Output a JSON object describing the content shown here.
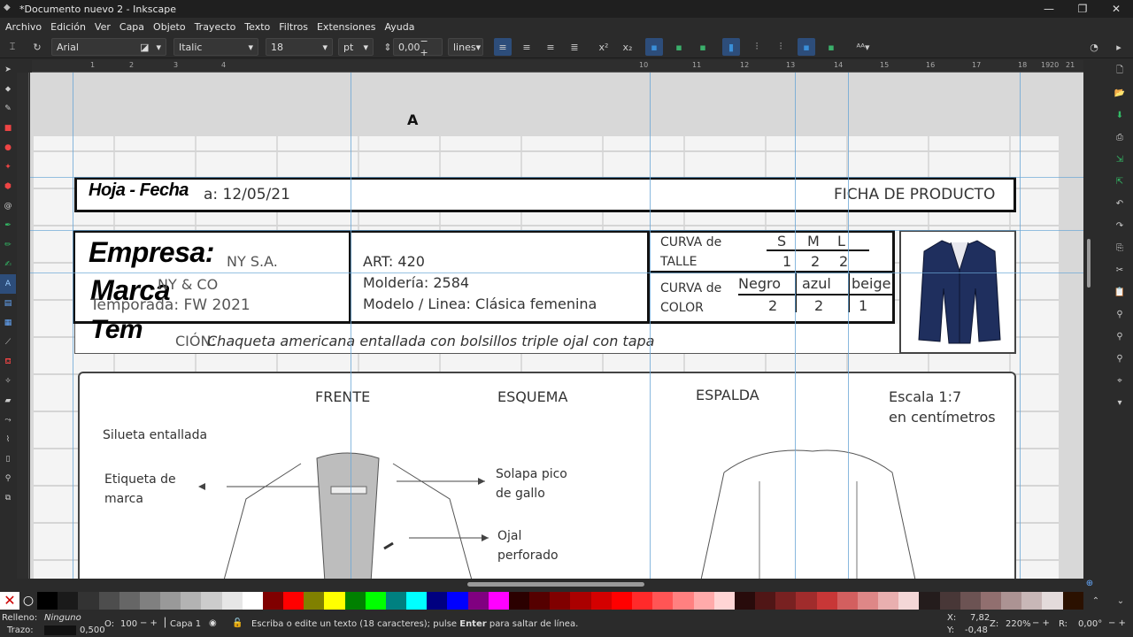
{
  "window": {
    "title": "*Documento nuevo 2 - Inkscape",
    "minimize": "—",
    "maximize": "❐",
    "close": "✕"
  },
  "menu": [
    "Archivo",
    "Edición",
    "Ver",
    "Capa",
    "Objeto",
    "Trayecto",
    "Texto",
    "Filtros",
    "Extensiones",
    "Ayuda"
  ],
  "textbar": {
    "font_family": "Arial",
    "font_style": "Italic",
    "font_size": "18",
    "unit": "pt",
    "spacing": "0,00",
    "line_mode": "lines"
  },
  "document": {
    "hoja_fecha": "Hoja - Fecha",
    "fecha_value": "a: 12/05/21",
    "ficha": "FICHA DE PRODUCTO",
    "empresa": "Empresa:",
    "marca": "Marca",
    "temporada": "Tem",
    "empresa_value": "NY S.A.",
    "marca_value": "NY & CO",
    "temporada_value": "Temporada: FW 2021",
    "art": "ART: 420",
    "molderia": "Moldería: 2584",
    "modelo": "Modelo / Linea: Clásica femenina",
    "curva_talle_1": "CURVA de",
    "curva_talle_2": "TALLE",
    "sizes": [
      "S",
      "M",
      "L"
    ],
    "size_qty": [
      "1",
      "2",
      "2"
    ],
    "curva_color_1": "CURVA de",
    "curva_color_2": "COLOR",
    "colors": [
      "Negro",
      "azul",
      "beige"
    ],
    "color_qty": [
      "2",
      "2",
      "1"
    ],
    "descripcion_label": "CIÓN:",
    "descripcion": "Chaqueta americana entallada con bolsillos triple ojal con tapa",
    "frente": "FRENTE",
    "esquema": "ESQUEMA",
    "espalda": "ESPALDA",
    "escala_1": "Escala 1:7",
    "escala_2": "en centímetros",
    "silueta": "Silueta entallada",
    "etiqueta_1": "Etiqueta de",
    "etiqueta_2": "marca",
    "solapa_1": "Solapa pico",
    "solapa_2": "de gallo",
    "ojal_1": "Ojal",
    "ojal_2": "perforado"
  },
  "status": {
    "relleno_label": "Relleno:",
    "relleno_value": "Ninguno",
    "trazo_label": "Trazo:",
    "trazo_value": "0,500",
    "opacity_label": "O:",
    "opacity_value": "100",
    "layer": "Capa 1",
    "message_pre": "Escriba o edite un texto (18 caracteres); pulse ",
    "message_key": "Enter",
    "message_post": " para saltar de línea.",
    "x_label": "X:",
    "x_value": "7,82",
    "y_label": "Y:",
    "y_value": "-0,48",
    "zoom_label": "Z:",
    "zoom_value": "220%",
    "rot_label": "R:",
    "rot_value": "0,00°"
  },
  "ruler_ticks": [
    "1",
    "2",
    "3",
    "4",
    "10",
    "11",
    "12",
    "13",
    "14",
    "15",
    "16",
    "17",
    "18",
    "19",
    "20",
    "21"
  ],
  "palette_colors": [
    "#000000",
    "#1a1a1a",
    "#333333",
    "#4d4d4d",
    "#666666",
    "#808080",
    "#999999",
    "#b3b3b3",
    "#cccccc",
    "#e6e6e6",
    "#ffffff",
    "#800000",
    "#ff0000",
    "#808000",
    "#ffff00",
    "#008000",
    "#00ff00",
    "#008080",
    "#00ffff",
    "#000080",
    "#0000ff",
    "#800080",
    "#ff00ff",
    "#2b0000",
    "#550000",
    "#800000",
    "#aa0000",
    "#d40000",
    "#ff0000",
    "#ff2a2a",
    "#ff5555",
    "#ff8080",
    "#ffaaaa",
    "#ffd5d5",
    "#280b0b",
    "#501616",
    "#782121",
    "#a02c2c",
    "#c83737",
    "#d35f5f",
    "#de8787",
    "#e9afaf",
    "#f4d7d7",
    "#241c1c",
    "#483737",
    "#6c5353",
    "#916f6f",
    "#ac9393",
    "#c8b7b7",
    "#e3dbdb",
    "#2b1100"
  ]
}
